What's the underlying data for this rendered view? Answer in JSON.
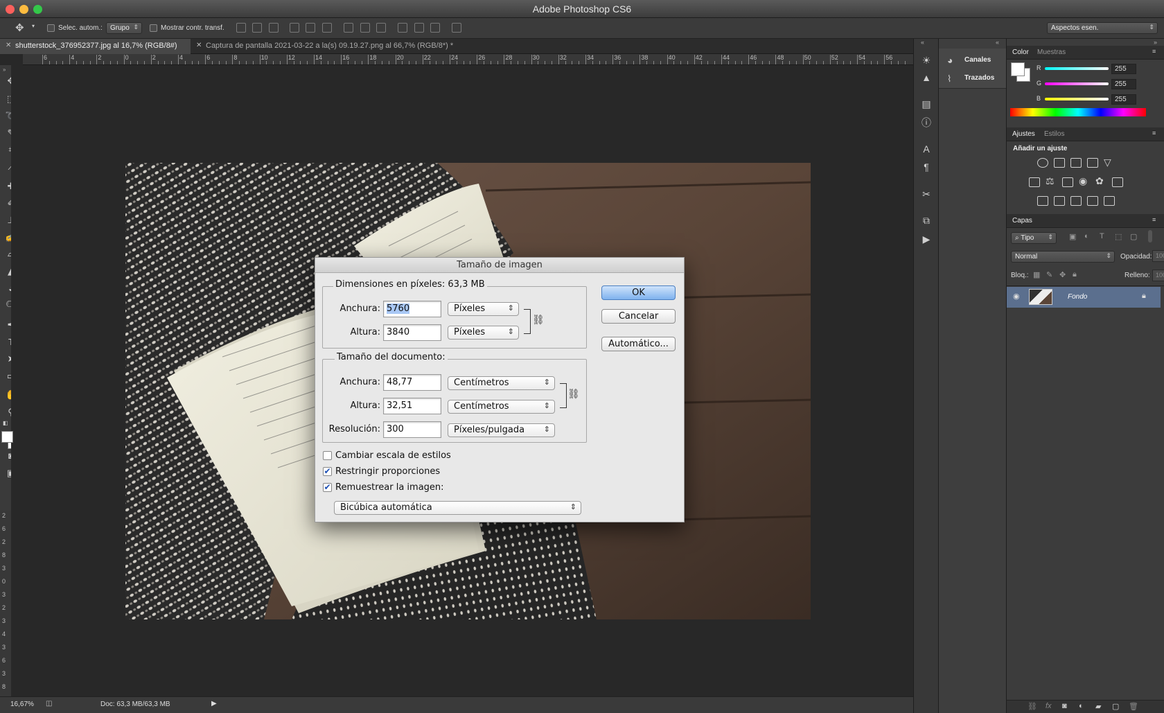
{
  "window": {
    "title": "Adobe Photoshop CS6"
  },
  "options_bar": {
    "auto_select_label": "Selec. autom.:",
    "auto_select_value": "Grupo",
    "transform_label": "Mostrar contr. transf.",
    "workspace": "Aspectos esen."
  },
  "tabs": [
    {
      "label": "shutterstock_376952377.jpg al 16,7% (RGB/8#)",
      "active": true
    },
    {
      "label": "Captura de pantalla 2021-03-22 a la(s) 09.19.27.png al 66,7% (RGB/8*) *",
      "active": false
    }
  ],
  "ruler": {
    "h_labels": [
      "6",
      "4",
      "2",
      "0",
      "2",
      "4",
      "6",
      "8",
      "10",
      "12",
      "14",
      "16",
      "18",
      "20",
      "22",
      "24",
      "26",
      "28",
      "30",
      "32",
      "34",
      "36",
      "38",
      "40",
      "42",
      "44",
      "46",
      "48",
      "50",
      "52",
      "54",
      "56"
    ],
    "v_labels": [
      "2",
      "6",
      "2",
      "8",
      "3",
      "0",
      "3",
      "2",
      "3",
      "4",
      "3",
      "6",
      "3",
      "8"
    ]
  },
  "status": {
    "zoom": "16,67%",
    "doc": "Doc: 63,3 MB/63,3 MB"
  },
  "panels_left": {
    "channels": "Canales",
    "paths": "Trazados"
  },
  "color_panel": {
    "tabs": [
      "Color",
      "Muestras"
    ],
    "channels": [
      {
        "name": "R",
        "value": "255"
      },
      {
        "name": "G",
        "value": "255"
      },
      {
        "name": "B",
        "value": "255"
      }
    ]
  },
  "adjustments_panel": {
    "tabs": [
      "Ajustes",
      "Estilos"
    ],
    "heading": "Añadir un ajuste"
  },
  "layers_panel": {
    "title": "Capas",
    "filter": "Tipo",
    "blend_mode": "Normal",
    "opacity_label": "Opacidad:",
    "opacity_value": "100%",
    "lock_label": "Bloq.:",
    "fill_label": "Relleno:",
    "fill_value": "100%",
    "layer_name": "Fondo"
  },
  "dialog": {
    "title": "Tamaño de imagen",
    "pixel_dims": {
      "legend": "Dimensiones en píxeles: 63,3 MB",
      "width_label": "Anchura:",
      "width_value": "5760",
      "width_unit": "Píxeles",
      "height_label": "Altura:",
      "height_value": "3840",
      "height_unit": "Píxeles"
    },
    "doc_size": {
      "legend": "Tamaño del documento:",
      "width_label": "Anchura:",
      "width_value": "48,77",
      "width_unit": "Centímetros",
      "height_label": "Altura:",
      "height_value": "32,51",
      "height_unit": "Centímetros",
      "res_label": "Resolución:",
      "res_value": "300",
      "res_unit": "Píxeles/pulgada"
    },
    "scale_styles": {
      "label": "Cambiar escala de estilos",
      "checked": false
    },
    "constrain": {
      "label": "Restringir proporciones",
      "checked": true
    },
    "resample": {
      "label": "Remuestrear la imagen:",
      "checked": true
    },
    "resample_method": "Bicúbica automática",
    "buttons": {
      "ok": "OK",
      "cancel": "Cancelar",
      "auto": "Automático..."
    }
  }
}
